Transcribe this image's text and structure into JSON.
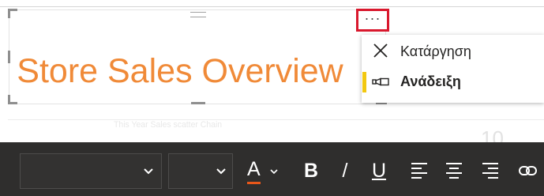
{
  "visual": {
    "title": "Store Sales Overview",
    "title_color": "#f08a38",
    "more_options": "···",
    "more_options_outline": "#d9182d"
  },
  "context_menu": {
    "items": [
      {
        "label": "Κατάργηση",
        "icon": "close-icon",
        "highlighted": false
      },
      {
        "label": "Ανάδειξη",
        "icon": "spotlight-icon",
        "highlighted": true
      }
    ],
    "highlight_color": "#f2c811"
  },
  "background_visual": {
    "caption": "This Year Sales scatter Chain",
    "value": "10"
  },
  "format_toolbar": {
    "font_family_value": "",
    "font_size_value": "",
    "font_color_glyph": "A",
    "font_color_underline": "#e8571a",
    "bold_glyph": "B",
    "italic_glyph": "/",
    "underline_glyph": "U",
    "background": "#2f2e2d",
    "buttons": [
      "font-color",
      "bold",
      "italic",
      "underline",
      "align-left",
      "align-center",
      "align-right",
      "insert-link"
    ]
  }
}
